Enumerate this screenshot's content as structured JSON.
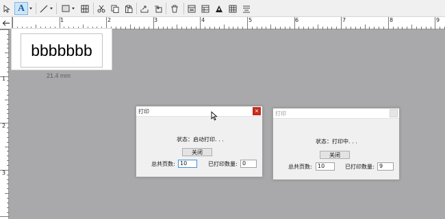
{
  "toolbar": {
    "tools": [
      {
        "name": "select-tool",
        "icon": "arrow-pointer-icon"
      },
      {
        "name": "text-tool",
        "icon": "text-a-icon",
        "active": true
      },
      {
        "name": "line-tool",
        "icon": "line-icon"
      },
      {
        "name": "rectangle-tool",
        "icon": "rectangle-icon"
      },
      {
        "name": "barcode-tool",
        "icon": "barcode-icon"
      },
      {
        "name": "cut-tool",
        "icon": "scissors-icon"
      },
      {
        "name": "copy-tool",
        "icon": "copy-icon"
      },
      {
        "name": "paste-tool",
        "icon": "paste-icon"
      },
      {
        "name": "export-tool",
        "icon": "export-icon"
      },
      {
        "name": "import-tool",
        "icon": "import-icon"
      },
      {
        "name": "delete-tool",
        "icon": "trash-icon"
      },
      {
        "name": "layout-tool",
        "icon": "layout-icon"
      },
      {
        "name": "table-tool",
        "icon": "table-icon"
      },
      {
        "name": "font-tool",
        "icon": "font-a-icon"
      },
      {
        "name": "grid-tool",
        "icon": "grid-icon"
      },
      {
        "name": "align-tool",
        "icon": "align-icon"
      }
    ],
    "text_tool_letter": "A"
  },
  "ruler": {
    "top_numbers": [
      "1",
      "2",
      "3",
      "4",
      "5",
      "6",
      "7",
      "8",
      "9"
    ],
    "left_numbers": [
      "1",
      "2",
      "3"
    ]
  },
  "label": {
    "text": "bbbbbbb",
    "width_readout": "21.4 mm"
  },
  "dialog_active": {
    "title": "打印",
    "close_symbol": "×",
    "status": "状态：启动打印. . .",
    "close_button": "关闭",
    "total_pages_label": "总共页数:",
    "total_pages_value": "10",
    "printed_label": "已打印数量:",
    "printed_value": "0"
  },
  "dialog_background": {
    "title": "打印",
    "status": "状态：打印中. . .",
    "close_button": "关闭",
    "total_pages_label": "总共页数:",
    "total_pages_value": "10",
    "printed_label": "已打印数量:",
    "printed_value": "9"
  },
  "colors": {
    "canvas_background": "#a9a9ab",
    "close_button_red": "#c42b1c",
    "active_tool_highlight": "#cde6f7"
  }
}
